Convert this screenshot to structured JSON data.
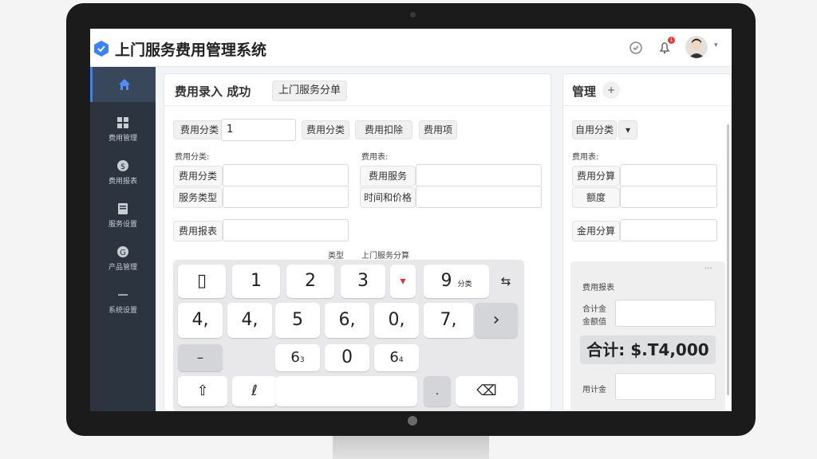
{
  "app": {
    "title": "上门服务费用管理系统",
    "notification_count": "1"
  },
  "sidebar": {
    "items": [
      {
        "label": ""
      },
      {
        "label": "费用管理"
      },
      {
        "label": "费用报表"
      },
      {
        "label": "服务设置"
      },
      {
        "label": "产品管理"
      },
      {
        "label": "系统设置"
      }
    ]
  },
  "main": {
    "heading": "费用录入 成功",
    "heading_button": "上门服务分单",
    "category_label": "费用分类",
    "category_value": "1",
    "chips": [
      "费用分类",
      "费用扣除",
      "费用项"
    ],
    "left_section_label": "费用分类:",
    "right_section_label": "费用表:",
    "left_rows": [
      "费用分类",
      "服务类型"
    ],
    "right_rows": [
      "费用服务",
      "时间和价格"
    ],
    "extra_label": "费用报表",
    "kbd_caption_left": "类型",
    "kbd_caption_right": "上门服务分算"
  },
  "keyboard": {
    "row1": [
      "▯",
      "1",
      "2",
      "3",
      "▾",
      "9",
      "⇆"
    ],
    "row1_sub": "分类",
    "row2": [
      "4,",
      "4,",
      "5",
      "6,",
      "0,",
      "7,",
      "›"
    ],
    "row3": [
      "–",
      "6",
      "0",
      "6"
    ],
    "row3_sub": [
      "3",
      "4"
    ],
    "row4": [
      "⇧",
      "ℓ",
      "",
      ".",
      "⌫"
    ]
  },
  "right_panel": {
    "title": "管理",
    "chip": "自用分类",
    "section_label": "费用表:",
    "rows": [
      "费用分算",
      "额度"
    ],
    "extra_label": "金用分算",
    "summary_title": "费用报表",
    "sum_labels": [
      "合计金",
      "金额值"
    ],
    "total": "合计: $.T4,000",
    "subtotal_label": "用计金"
  },
  "colors": {
    "accent": "#3b82f6",
    "sidebar": "#2c3440",
    "badge": "#e53935"
  }
}
